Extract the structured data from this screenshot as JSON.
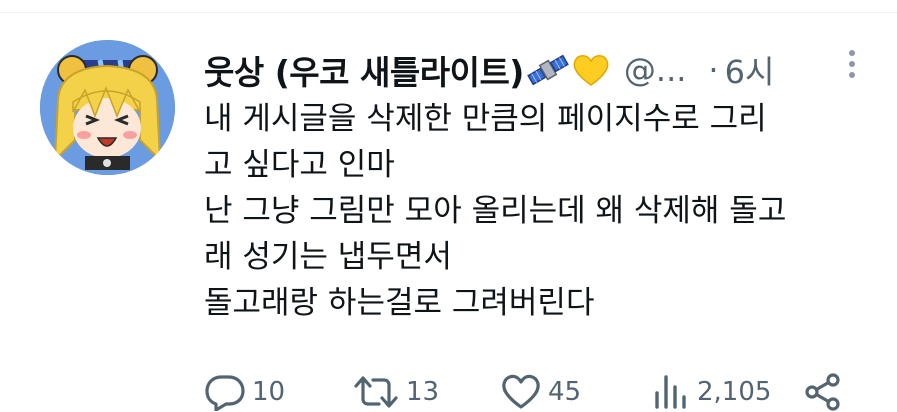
{
  "tweet": {
    "display_name": "웃상 (우코 새틀라이트)",
    "emoji": [
      "satellite-icon",
      "yellow-heart-icon"
    ],
    "handle": "@...",
    "separator": "·",
    "time": "6시",
    "lines": [
      "내 게시글을 삭제한 만큼의 페이지수로 그리",
      "고 싶다고 인마",
      "난 그냥 그림만 모아 올리는데 왜 삭제해 돌고",
      "래 성기는 냅두면서",
      "돌고래랑 하는걸로 그려버린다"
    ],
    "stats": {
      "replies": "10",
      "retweets": "13",
      "likes": "45",
      "views": "2,105"
    }
  },
  "colors": {
    "text": "#0f1419",
    "secondary": "#536471",
    "divider": "#eff3f4"
  }
}
